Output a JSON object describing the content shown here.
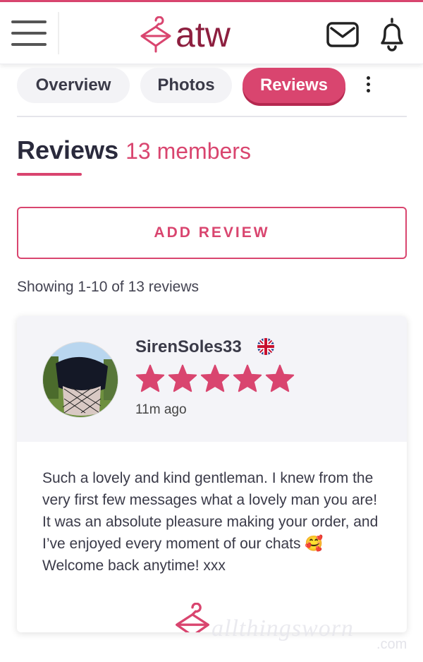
{
  "brand": {
    "logo_text": "atw",
    "accent": "#d9456f",
    "logo_color": "#8d1f3f"
  },
  "header": {
    "icons": [
      "hamburger-menu-icon",
      "mail-icon",
      "bell-icon"
    ]
  },
  "tabs": [
    {
      "label": "Overview",
      "active": false
    },
    {
      "label": "Photos",
      "active": false
    },
    {
      "label": "Reviews",
      "active": true
    }
  ],
  "section": {
    "title": "Reviews",
    "count": "13 members"
  },
  "add_review_label": "ADD REVIEW",
  "showing_text": "Showing 1-10 of 13 reviews",
  "reviews": [
    {
      "name": "SirenSoles33",
      "flag": "uk-flag-icon",
      "rating": 5,
      "rating_max": 5,
      "time": "11m ago",
      "text": "Such a lovely and kind gentleman. I knew from the very first few messages what a lovely man you are! It was an absolute pleasure making your order, and I’ve enjoyed every moment of our chats 🥰 Welcome back anytime! xxx"
    }
  ],
  "watermark": {
    "main": "allthingsworn",
    "suffix": ".com"
  }
}
